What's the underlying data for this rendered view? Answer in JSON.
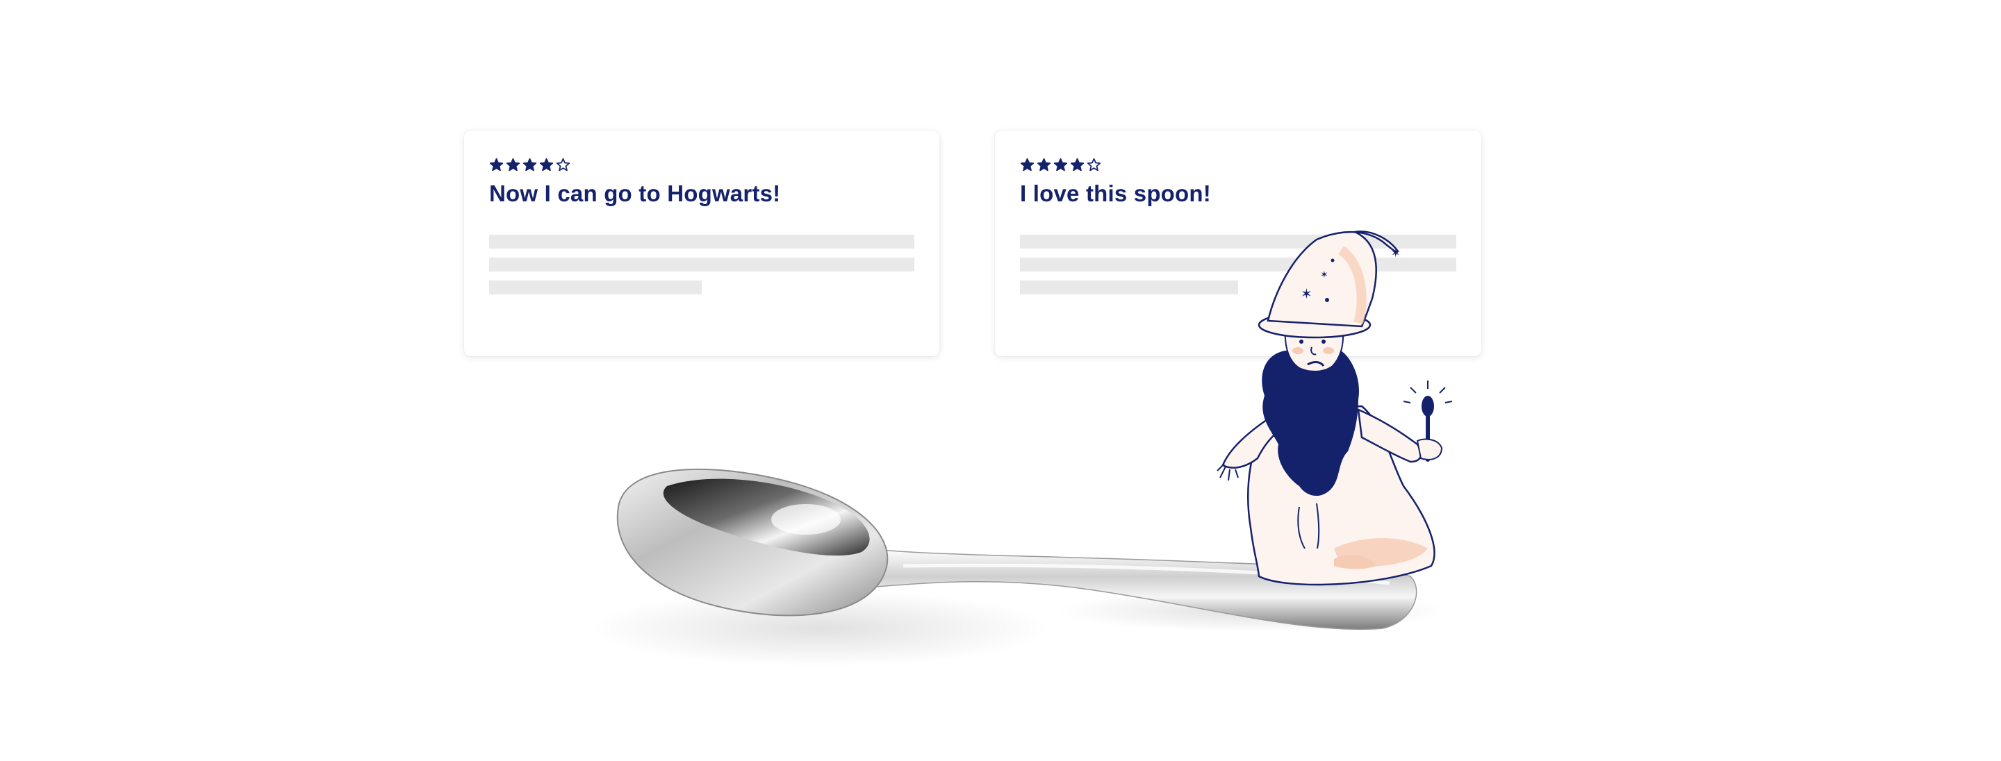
{
  "reviews": [
    {
      "title": "Now I can go to Hogwarts!",
      "rating": 4,
      "max_rating": 5
    },
    {
      "title": "I love this spoon!",
      "rating": 4,
      "max_rating": 5
    }
  ],
  "colors": {
    "navy": "#14216b",
    "placeholder": "#e9e9e9",
    "robe": "#fdf4ef",
    "robe_accent": "#f6cbb4",
    "silver": "#c8c8c8"
  },
  "icons": [
    "star-filled-icon",
    "star-outline-icon",
    "spoon-image",
    "wizard-illustration"
  ]
}
